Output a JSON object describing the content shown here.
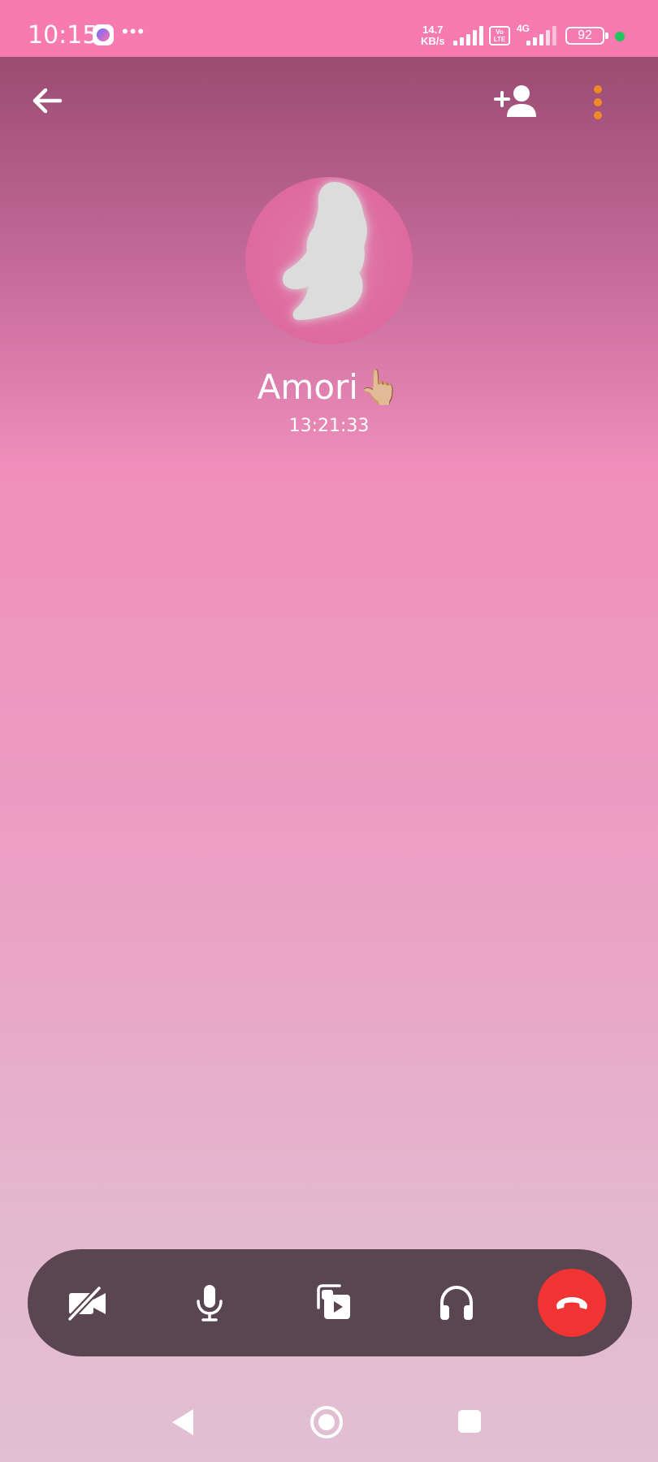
{
  "status_bar": {
    "time": "10:15",
    "dots": "•••",
    "network_speed": "14.7",
    "network_speed_unit": "KB/s",
    "volte": "Vo LTE",
    "network_type": "4G",
    "battery": "92"
  },
  "call": {
    "contact_name": "Amori👆🏼",
    "duration": "13:21:33"
  },
  "icons": {
    "back": "arrow-left-icon",
    "add_person": "add-person-icon",
    "more": "more-vertical-icon",
    "camera_off": "video-off-icon",
    "mic": "microphone-icon",
    "share": "media-share-icon",
    "audio": "headphones-icon",
    "end_call": "end-call-icon"
  },
  "colors": {
    "status_bar": "#f77bb0",
    "control_bar": "#5a4650",
    "end_call": "#f03333",
    "more_dots": "#f08a24"
  }
}
